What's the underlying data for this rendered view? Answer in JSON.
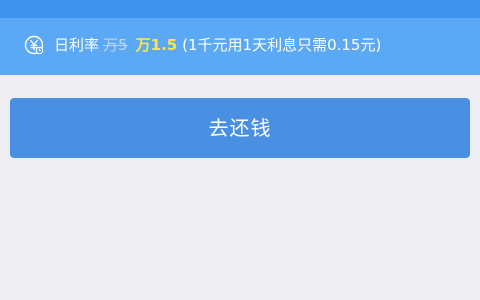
{
  "banner": {
    "icon": "yuan-coin-icon",
    "label": "日利率",
    "old_rate": "万5",
    "new_rate": "万1.5",
    "note": "(1千元用1天利息只需0.15元)"
  },
  "actions": {
    "repay_label": "去还钱"
  },
  "colors": {
    "top_bar": "#3f93ec",
    "banner_bg": "#5ba8f4",
    "highlight": "#ffe24a",
    "button_bg": "#4a90e2",
    "page_bg": "#eeeef2"
  }
}
